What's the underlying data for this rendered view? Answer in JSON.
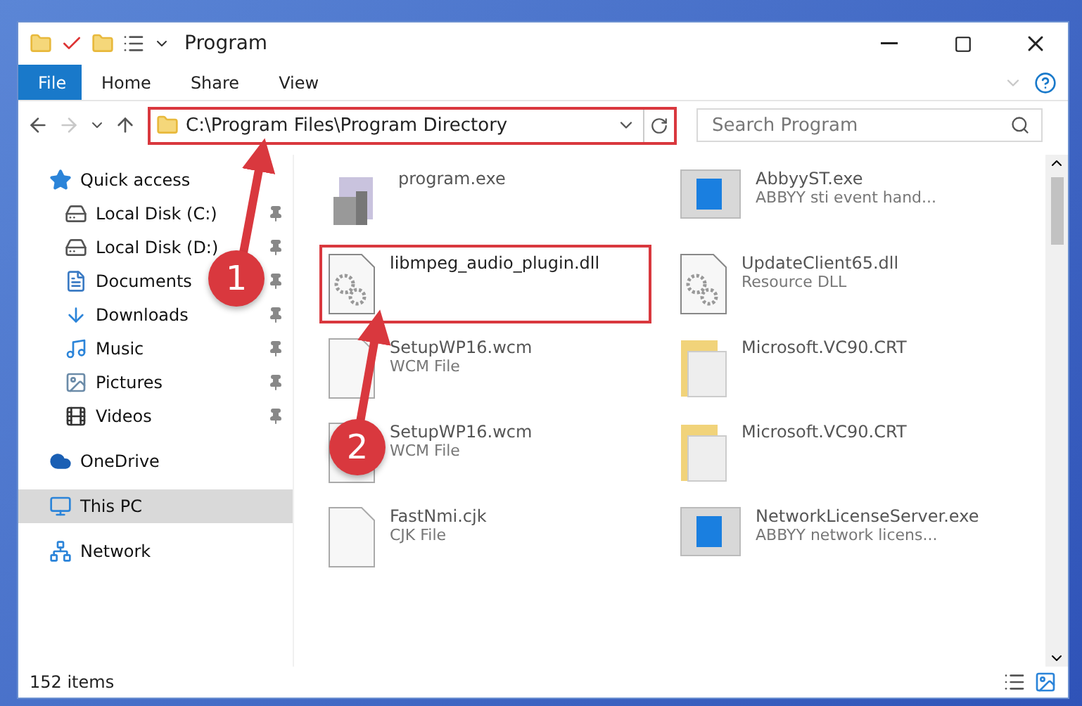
{
  "window": {
    "title": "Program"
  },
  "ribbon_tabs": [
    {
      "label": "File",
      "selected": true
    },
    {
      "label": "Home",
      "selected": false
    },
    {
      "label": "Share",
      "selected": false
    },
    {
      "label": "View",
      "selected": false
    }
  ],
  "address": {
    "path": "C:\\Program Files\\Program Directory",
    "highlighted": true
  },
  "search": {
    "placeholder": "Search Program"
  },
  "sidebar": {
    "items": [
      {
        "label": "Quick access",
        "kind": "star",
        "selected": false,
        "children": [
          {
            "label": "Local Disk (C:)",
            "kind": "disk",
            "pinned": true
          },
          {
            "label": "Local Disk (D:)",
            "kind": "disk",
            "pinned": true
          },
          {
            "label": "Documents",
            "kind": "document",
            "pinned": true
          },
          {
            "label": "Downloads",
            "kind": "download",
            "pinned": true
          },
          {
            "label": "Music",
            "kind": "music",
            "pinned": true
          },
          {
            "label": "Pictures",
            "kind": "pictures",
            "pinned": true
          },
          {
            "label": "Videos",
            "kind": "videos",
            "pinned": true
          }
        ]
      },
      {
        "label": "OneDrive",
        "kind": "cloud",
        "selected": false
      },
      {
        "label": "This PC",
        "kind": "pc",
        "selected": true
      },
      {
        "label": "Network",
        "kind": "network",
        "selected": false
      }
    ]
  },
  "files": [
    {
      "name": "program.exe",
      "kind": "installer",
      "highlighted": false
    },
    {
      "name": "AbbyyST.exe",
      "type": "ABBYY sti event hand...",
      "kind": "app",
      "highlighted": false
    },
    {
      "name": "libmpeg_audio_plugin.dll",
      "kind": "dll",
      "highlighted": true
    },
    {
      "name": "UpdateClient65.dll",
      "type": "Resource DLL",
      "kind": "dll",
      "highlighted": false
    },
    {
      "name": "SetupWP16.wcm",
      "type": "WCM File",
      "kind": "file",
      "highlighted": false
    },
    {
      "name": "Microsoft.VC90.CRT",
      "kind": "folder",
      "highlighted": false
    },
    {
      "name": "SetupWP16.wcm",
      "type": "WCM File",
      "kind": "file",
      "highlighted": false
    },
    {
      "name": "Microsoft.VC90.CRT",
      "kind": "folder",
      "highlighted": false
    },
    {
      "name": "FastNmi.cjk",
      "type": "CJK File",
      "kind": "file",
      "highlighted": false
    },
    {
      "name": "NetworkLicenseServer.exe",
      "type": "ABBYY network licens...",
      "kind": "app",
      "highlighted": false
    }
  ],
  "callouts": [
    {
      "number": "1"
    },
    {
      "number": "2"
    }
  ],
  "status_bar": {
    "count": "152 items"
  }
}
